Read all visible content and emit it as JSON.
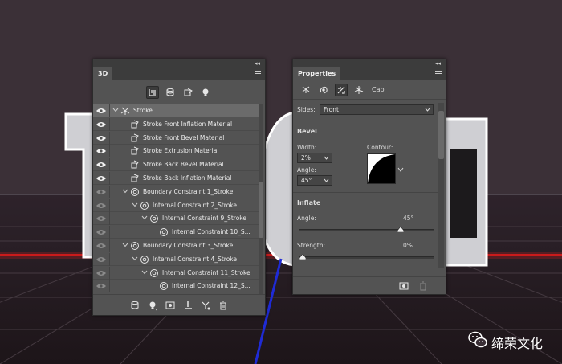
{
  "panel3d": {
    "tab": "3D",
    "collapse_glyph": "◂◂",
    "toolbar": [
      {
        "icon": "scene-filter-icon",
        "active": true
      },
      {
        "icon": "mesh-filter-icon",
        "active": false
      },
      {
        "icon": "material-filter-icon",
        "active": false
      },
      {
        "icon": "light-filter-icon",
        "active": false
      }
    ],
    "rows": [
      {
        "label": "Stroke",
        "indent": 0,
        "chevron": true,
        "icon": "mesh-icon",
        "selected": true,
        "eye": "bright"
      },
      {
        "label": "Stroke Front Inflation Material",
        "indent": 1,
        "chevron": false,
        "icon": "material-icon",
        "selected": false,
        "eye": "bright"
      },
      {
        "label": "Stroke Front Bevel Material",
        "indent": 1,
        "chevron": false,
        "icon": "material-icon",
        "selected": false,
        "eye": "bright"
      },
      {
        "label": "Stroke Extrusion Material",
        "indent": 1,
        "chevron": false,
        "icon": "material-icon",
        "selected": false,
        "eye": "bright"
      },
      {
        "label": "Stroke Back Bevel Material",
        "indent": 1,
        "chevron": false,
        "icon": "material-icon",
        "selected": false,
        "eye": "bright"
      },
      {
        "label": "Stroke Back Inflation Material",
        "indent": 1,
        "chevron": false,
        "icon": "material-icon",
        "selected": false,
        "eye": "bright"
      },
      {
        "label": "Boundary Constraint 1_Stroke",
        "indent": 1,
        "chevron": true,
        "icon": "constraint-icon",
        "selected": false,
        "eye": "dim"
      },
      {
        "label": "Internal Constraint 2_Stroke",
        "indent": 2,
        "chevron": true,
        "icon": "constraint-icon",
        "selected": false,
        "eye": "dim"
      },
      {
        "label": "Internal Constraint 9_Stroke",
        "indent": 3,
        "chevron": true,
        "icon": "constraint-icon",
        "selected": false,
        "eye": "dim"
      },
      {
        "label": "Internal Constraint 10_S...",
        "indent": 4,
        "chevron": false,
        "icon": "constraint-icon",
        "selected": false,
        "eye": "dim"
      },
      {
        "label": "Boundary Constraint 3_Stroke",
        "indent": 1,
        "chevron": true,
        "icon": "constraint-icon",
        "selected": false,
        "eye": "dim"
      },
      {
        "label": "Internal Constraint 4_Stroke",
        "indent": 2,
        "chevron": true,
        "icon": "constraint-icon",
        "selected": false,
        "eye": "dim"
      },
      {
        "label": "Internal Constraint 11_Stroke",
        "indent": 3,
        "chevron": true,
        "icon": "constraint-icon",
        "selected": false,
        "eye": "dim"
      },
      {
        "label": "Internal Constraint 12_S...",
        "indent": 4,
        "chevron": false,
        "icon": "constraint-icon",
        "selected": false,
        "eye": "dim"
      }
    ],
    "bottom_icons": [
      "new-mesh-icon",
      "new-light-icon",
      "render-icon",
      "ground-icon",
      "split-icon",
      "trash-icon"
    ]
  },
  "properties": {
    "tab": "Properties",
    "collapse_glyph": "◂◂",
    "tabs": [
      {
        "icon": "mesh-tab-icon",
        "active": false
      },
      {
        "icon": "deform-tab-icon",
        "active": false
      },
      {
        "icon": "cap-tab-icon",
        "active": true
      },
      {
        "icon": "coordinates-tab-icon",
        "active": false
      }
    ],
    "cap_label": "Cap",
    "sides_label": "Sides:",
    "sides_value": "Front",
    "bevel_title": "Bevel",
    "width_label": "Width:",
    "width_value": "2%",
    "contour_label": "Contour:",
    "angle_label": "Angle:",
    "angle_value": "45°",
    "inflate_title": "Inflate",
    "inflate_angle_label": "Angle:",
    "inflate_angle_value": "45°",
    "inflate_angle_fraction": 0.75,
    "strength_label": "Strength:",
    "strength_value": "0%",
    "strength_fraction": 0.0
  },
  "watermark": {
    "text": "缔荣文化"
  },
  "colors": {
    "panel_bg": "#535353",
    "panel_dark": "#3c3c3c",
    "selection": "#6b6b6b",
    "scene_bg": "#3a2f36"
  }
}
